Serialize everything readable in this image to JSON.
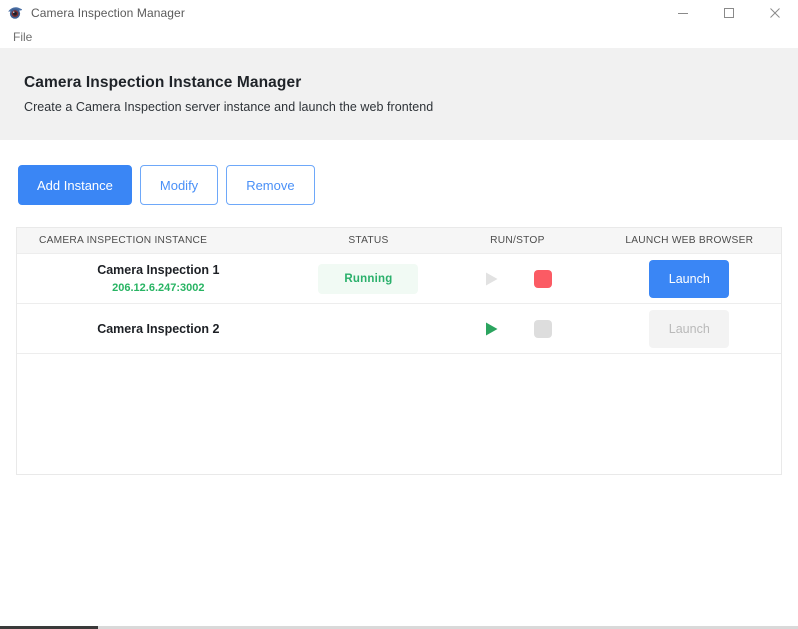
{
  "window": {
    "title": "Camera Inspection Manager",
    "app_icon": "camera-eye-icon",
    "controls": {
      "minimize": "minimize-icon",
      "maximize": "maximize-icon",
      "close": "close-icon"
    }
  },
  "menubar": {
    "items": [
      {
        "label": "File"
      }
    ]
  },
  "header": {
    "title": "Camera Inspection Instance Manager",
    "subtitle": "Create a Camera Inspection server instance and launch the web frontend"
  },
  "toolbar": {
    "add_instance_label": "Add Instance",
    "modify_label": "Modify",
    "remove_label": "Remove"
  },
  "table": {
    "columns": [
      {
        "key": "name",
        "label": "CAMERA INSPECTION INSTANCE"
      },
      {
        "key": "status",
        "label": "STATUS"
      },
      {
        "key": "run_stop",
        "label": "RUN/STOP"
      },
      {
        "key": "launch",
        "label": "LAUNCH WEB BROWSER"
      }
    ],
    "rows": [
      {
        "name": "Camera Inspection 1",
        "address": "206.12.6.247:3002",
        "status": "Running",
        "status_visible": true,
        "run_enabled": false,
        "stop_enabled": true,
        "launch_label": "Launch",
        "launch_enabled": true
      },
      {
        "name": "Camera Inspection 2",
        "address": "",
        "status": "",
        "status_visible": false,
        "run_enabled": true,
        "stop_enabled": false,
        "launch_label": "Launch",
        "launch_enabled": false
      }
    ]
  },
  "colors": {
    "accent_blue": "#3a86f5",
    "outline_blue": "#6ea8f9",
    "status_green": "#2ab06b",
    "address_green": "#28b463",
    "stop_red": "#fb5b64",
    "run_green": "#2ba45f",
    "disabled_gray": "#dddddd",
    "header_band": "#f1f1f1",
    "table_head": "#f6f6f6"
  }
}
